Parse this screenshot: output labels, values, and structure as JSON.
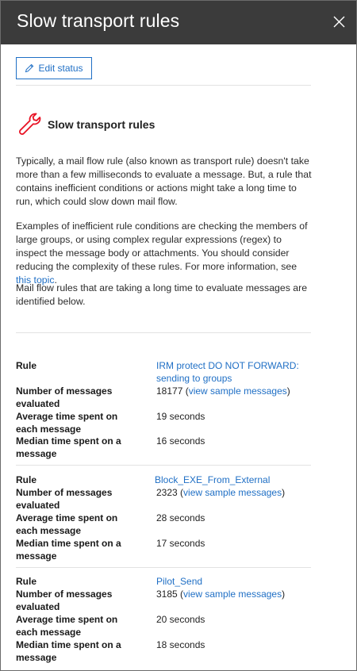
{
  "panel": {
    "title": "Slow transport rules",
    "close_icon": "close-icon"
  },
  "toolbar": {
    "edit_status_label": "Edit status",
    "edit_icon": "pencil-icon"
  },
  "section": {
    "icon": "wrench-icon",
    "icon_color": "#e81123",
    "title": "Slow transport rules",
    "para1": "Typically, a mail flow rule (also known as transport rule) doesn't take more than a few milliseconds to evaluate a message. But, a rule that contains inefficient conditions or actions might take a long time to run, which could slow down mail flow.",
    "para2_text": "Examples of inefficient rule conditions are checking the members of large groups, or using complex regular expressions (regex) to inspect the message body or attachments. You should consider reducing the complexity of these rules. For more information, see ",
    "para2_link": "this topic",
    "para2_end": ".",
    "para3": "Mail flow rules that are taking a long time to evaluate messages are identified below."
  },
  "labels": {
    "rule": "Rule",
    "messages": "Number of messages evaluated",
    "average": "Average time spent on each message",
    "median": "Median time spent on a message",
    "view_samples": "view sample messages"
  },
  "rules": [
    {
      "name": "IRM protect DO NOT FORWARD: sending to groups",
      "count": "18177",
      "average": "19 seconds",
      "median": "16 seconds"
    },
    {
      "name": "Block_EXE_From_External",
      "count": "2323",
      "average": "28 seconds",
      "median": "17 seconds"
    },
    {
      "name": "Pilot_Send",
      "count": "3185",
      "average": "20 seconds",
      "median": "18 seconds"
    }
  ],
  "colors": {
    "header_bg": "#3b3b3b",
    "accent": "#1f6fc5"
  }
}
